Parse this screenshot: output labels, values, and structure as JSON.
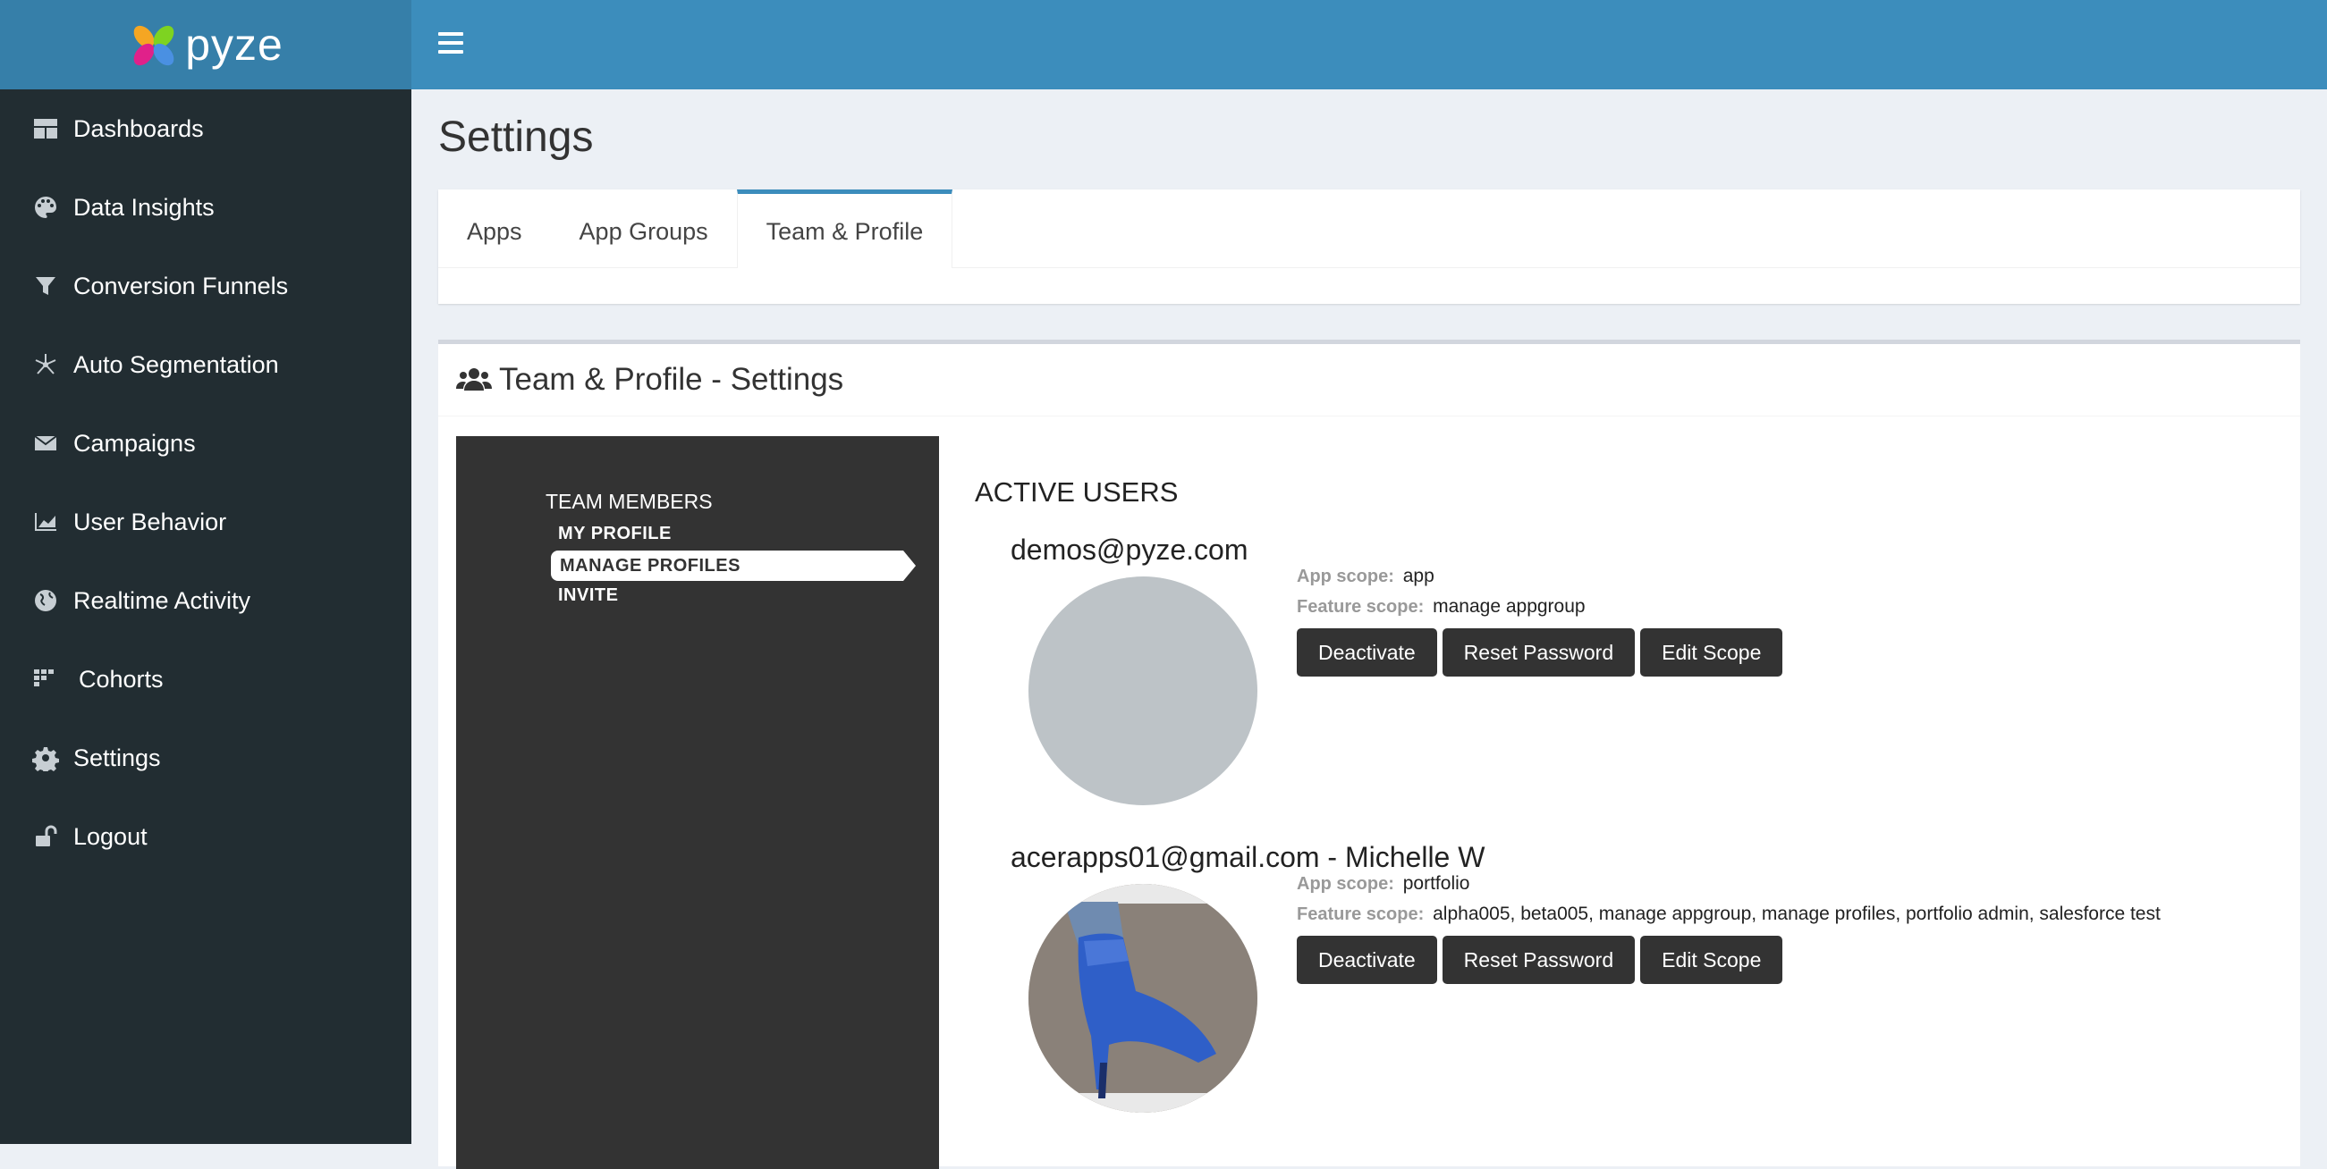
{
  "brand": {
    "name": "pyze"
  },
  "sidebar": {
    "items": [
      {
        "label": "Dashboards",
        "icon": "dashboard-icon"
      },
      {
        "label": "Data Insights",
        "icon": "palette-icon"
      },
      {
        "label": "Conversion Funnels",
        "icon": "filter-icon"
      },
      {
        "label": "Auto Segmentation",
        "icon": "segmentation-icon"
      },
      {
        "label": "Campaigns",
        "icon": "envelope-icon"
      },
      {
        "label": "User Behavior",
        "icon": "area-chart-icon"
      },
      {
        "label": "Realtime Activity",
        "icon": "globe-icon"
      },
      {
        "label": "Cohorts",
        "icon": "cohorts-icon"
      },
      {
        "label": "Settings",
        "icon": "gear-icon"
      },
      {
        "label": "Logout",
        "icon": "unlock-icon"
      }
    ]
  },
  "page": {
    "title": "Settings"
  },
  "tabs": [
    {
      "label": "Apps",
      "active": false
    },
    {
      "label": "App Groups",
      "active": false
    },
    {
      "label": "Team & Profile",
      "active": true
    }
  ],
  "panel": {
    "title": "Team & Profile - Settings",
    "subnav": {
      "heading": "TEAM MEMBERS",
      "items": [
        {
          "label": "MY PROFILE",
          "active": false
        },
        {
          "label": "MANAGE PROFILES",
          "active": true
        },
        {
          "label": "INVITE",
          "active": false
        }
      ]
    },
    "active_users_title": "ACTIVE USERS",
    "labels": {
      "app_scope": "App scope:",
      "feature_scope": "Feature scope:"
    },
    "buttons": {
      "deactivate": "Deactivate",
      "reset_password": "Reset Password",
      "edit_scope": "Edit Scope"
    },
    "users": [
      {
        "email": "demos@pyze.com",
        "app_scope": "app",
        "feature_scope": "manage appgroup",
        "avatar": "placeholder"
      },
      {
        "email": "acerapps01@gmail.com - Michelle W",
        "app_scope": "portfolio",
        "feature_scope": "alpha005, beta005, manage appgroup, manage profiles, portfolio admin, salesforce test",
        "avatar": "photo of blue high-heeled ankle boot"
      }
    ]
  },
  "colors": {
    "header": "#3c8dbc",
    "logo_bar": "#367fa9",
    "sidebar": "#222d32",
    "subnav": "#333333",
    "button": "#333333"
  }
}
